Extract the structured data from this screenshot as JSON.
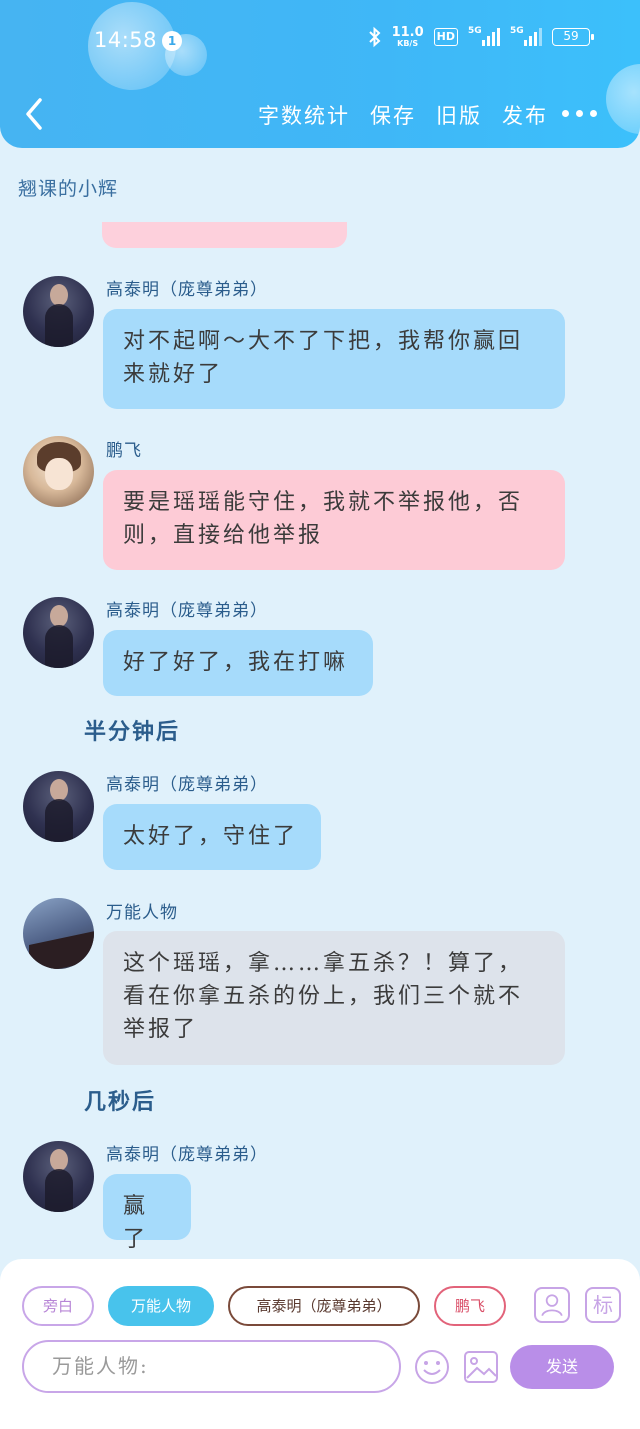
{
  "status_bar": {
    "time": "14:58",
    "notification_count": "1",
    "net_speed_value": "11.0",
    "net_speed_unit": "KB/S",
    "hd_label": "HD",
    "signal1_label": "5G",
    "signal2_label": "5G",
    "battery": "59"
  },
  "toolbar": {
    "back_icon": "chevron-left-icon",
    "word_count": "字数统计",
    "save": "保存",
    "old_version": "旧版",
    "publish": "发布",
    "more_icon": "more-dots-icon"
  },
  "chat": {
    "title": "翘课的小辉",
    "messages": [
      {
        "speaker": "高泰明（庞尊弟弟）",
        "text": "对不起啊～大不了下把，我帮你赢回来就好了",
        "style": "blue"
      },
      {
        "speaker": "鹏飞",
        "text": "要是瑶瑶能守住，我就不举报他，否则，直接给他举报",
        "style": "pink"
      },
      {
        "speaker": "高泰明（庞尊弟弟）",
        "text": "好了好了，我在打嘛",
        "style": "blue"
      },
      {
        "narration": "半分钟后"
      },
      {
        "speaker": "高泰明（庞尊弟弟）",
        "text": "太好了，守住了",
        "style": "blue"
      },
      {
        "speaker": "万能人物",
        "text": "这个瑶瑶，拿……拿五杀？！算了，看在你拿五杀的份上，我们三个就不举报了",
        "style": "gray"
      },
      {
        "narration": "几秒后"
      },
      {
        "speaker": "高泰明（庞尊弟弟）",
        "text": "赢了",
        "style": "blue"
      }
    ]
  },
  "composer": {
    "chips": [
      "旁白",
      "万能人物",
      "高泰明（庞尊弟弟）",
      "鹏飞"
    ],
    "selected_chip": "万能人物",
    "person_icon": "person-card-icon",
    "mark_label": "标",
    "input_placeholder": "万能人物:",
    "emoji_icon": "emoji-icon",
    "image_icon": "image-icon",
    "send_label": "发送"
  },
  "colors": {
    "header_blue": "#46b4f2",
    "bubble_blue": "#a6dbfb",
    "bubble_pink": "#fdcbd6",
    "bubble_gray": "#dde3eb",
    "send_purple": "#b98ee8",
    "chip_selected": "#48c3ec"
  }
}
